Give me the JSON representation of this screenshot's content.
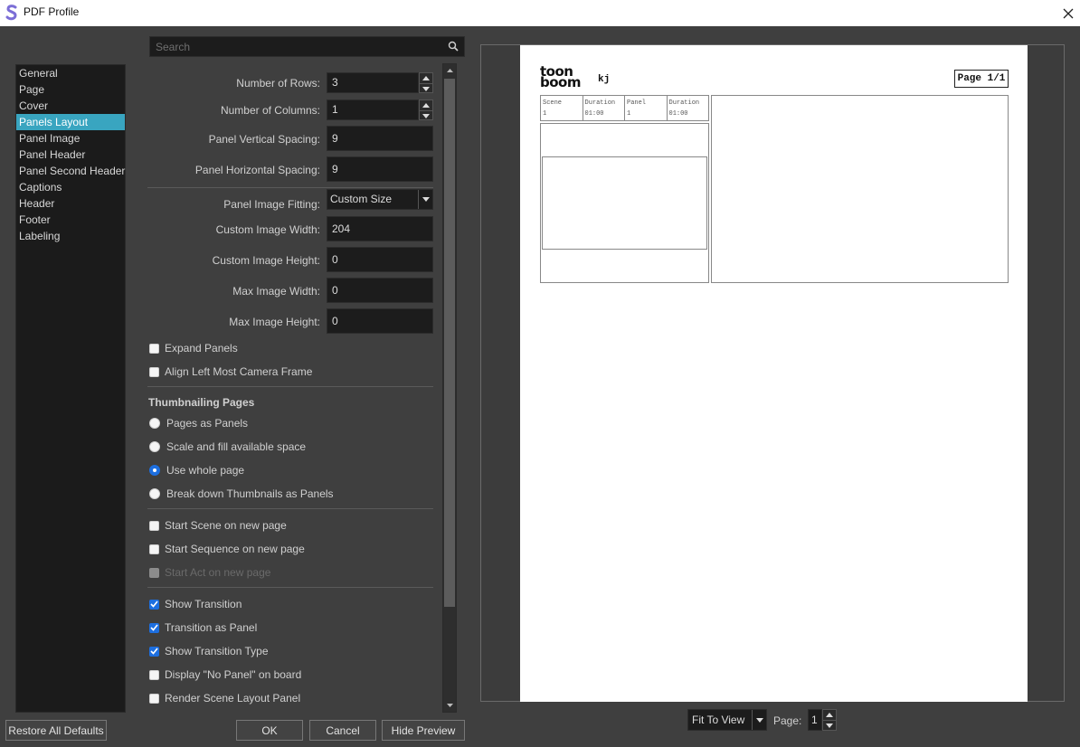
{
  "window": {
    "title": "PDF Profile"
  },
  "sidebar": {
    "items": [
      {
        "label": "General"
      },
      {
        "label": "Page"
      },
      {
        "label": "Cover"
      },
      {
        "label": "Panels Layout",
        "selected": true
      },
      {
        "label": "Panel Image"
      },
      {
        "label": "Panel Header"
      },
      {
        "label": "Panel Second Header"
      },
      {
        "label": "Captions"
      },
      {
        "label": "Header"
      },
      {
        "label": "Footer"
      },
      {
        "label": "Labeling"
      }
    ]
  },
  "search": {
    "placeholder": "Search",
    "value": ""
  },
  "form": {
    "rows_label": "Number of Rows:",
    "rows_value": "3",
    "columns_label": "Number of Columns:",
    "columns_value": "1",
    "vspacing_label": "Panel Vertical Spacing:",
    "vspacing_value": "9",
    "hspacing_label": "Panel Horizontal Spacing:",
    "hspacing_value": "9",
    "fitting_label": "Panel Image Fitting:",
    "fitting_value": "Custom Size",
    "custom_width_label": "Custom Image Width:",
    "custom_width_value": "204",
    "custom_height_label": "Custom Image Height:",
    "custom_height_value": "0",
    "max_width_label": "Max Image Width:",
    "max_width_value": "0",
    "max_height_label": "Max Image Height:",
    "max_height_value": "0",
    "expand_panels": {
      "label": "Expand Panels",
      "checked": false
    },
    "align_left": {
      "label": "Align Left Most Camera Frame",
      "checked": false
    },
    "thumb_title": "Thumbnailing Pages",
    "thumb_options": [
      {
        "label": "Pages as Panels",
        "checked": false
      },
      {
        "label": "Scale and fill available space",
        "checked": false
      },
      {
        "label": "Use whole page",
        "checked": true
      },
      {
        "label": "Break down Thumbnails as Panels",
        "checked": false
      }
    ],
    "start_scene": {
      "label": "Start Scene on new page",
      "checked": false
    },
    "start_sequence": {
      "label": "Start Sequence on new page",
      "checked": false
    },
    "start_act": {
      "label": "Start Act on new page",
      "checked": false,
      "disabled": true
    },
    "show_transition": {
      "label": "Show Transition",
      "checked": true
    },
    "transition_panel": {
      "label": "Transition as Panel",
      "checked": true
    },
    "show_transition_type": {
      "label": "Show Transition Type",
      "checked": true
    },
    "display_no_panel": {
      "label": "Display \"No Panel\" on board",
      "checked": false
    },
    "render_scene_layout": {
      "label": "Render Scene Layout Panel",
      "checked": false
    }
  },
  "buttons": {
    "restore": "Restore All Defaults",
    "ok": "OK",
    "cancel": "Cancel",
    "hide_preview": "Hide Preview"
  },
  "preview": {
    "logo_line1": "toon",
    "logo_line2": "boom",
    "doc_title": "kj",
    "page_label": "Page 1/1",
    "header_cells": [
      {
        "title": "Scene",
        "value": "1"
      },
      {
        "title": "Duration",
        "value": "01:00"
      },
      {
        "title": "Panel",
        "value": "1"
      },
      {
        "title": "Duration",
        "value": "01:00"
      }
    ]
  },
  "footer": {
    "zoom_value": "Fit To View",
    "page_label": "Page:",
    "page_value": "1"
  },
  "colors": {
    "accent": "#39a5c0",
    "check": "#1d6fe0",
    "background": "#3f3f3f"
  }
}
